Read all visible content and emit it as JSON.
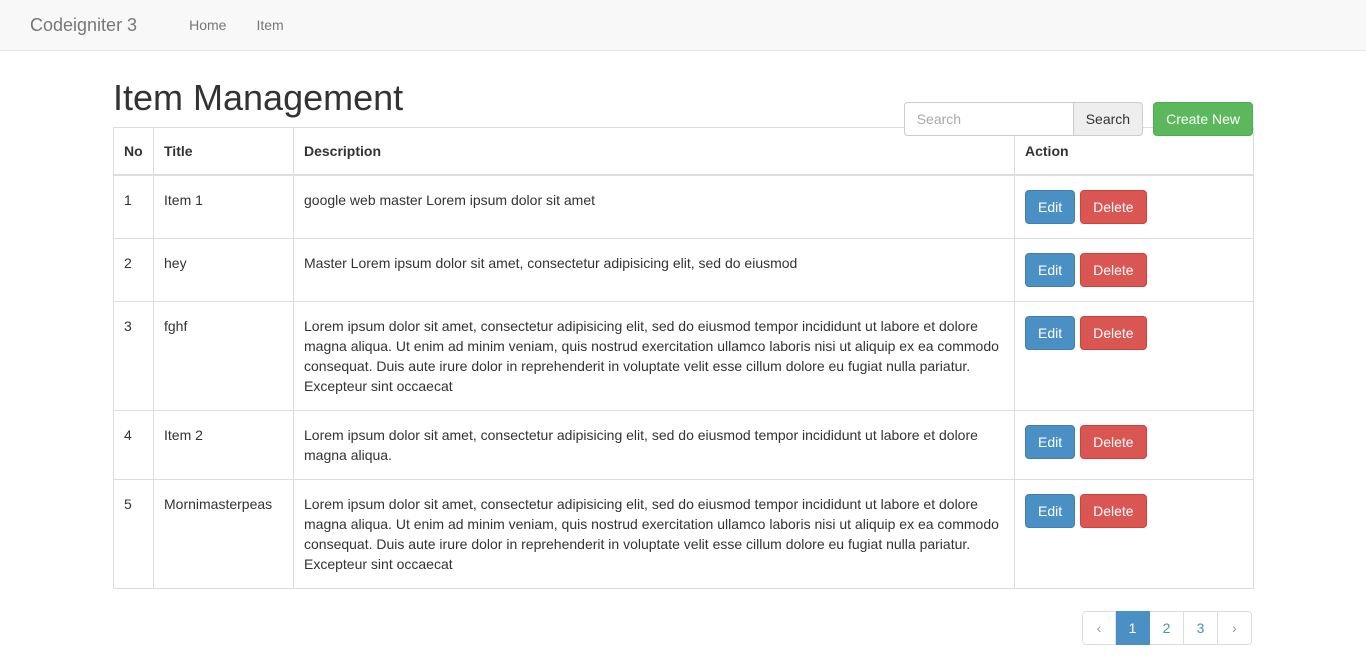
{
  "navbar": {
    "brand": "Codeigniter 3",
    "links": [
      {
        "label": "Home"
      },
      {
        "label": "Item"
      }
    ]
  },
  "page": {
    "title": "Item Management"
  },
  "search": {
    "value": "",
    "placeholder": "Search",
    "button_label": "Search"
  },
  "create": {
    "label": "Create New"
  },
  "table": {
    "headers": {
      "no": "No",
      "title": "Title",
      "description": "Description",
      "action": "Action"
    },
    "actions": {
      "edit": "Edit",
      "delete": "Delete"
    },
    "rows": [
      {
        "no": "1",
        "title": "Item 1",
        "description": "google web master Lorem ipsum dolor sit amet"
      },
      {
        "no": "2",
        "title": "hey",
        "description": "Master Lorem ipsum dolor sit amet, consectetur adipisicing elit, sed do eiusmod"
      },
      {
        "no": "3",
        "title": "fghf",
        "description": "Lorem ipsum dolor sit amet, consectetur adipisicing elit, sed do eiusmod tempor incididunt ut labore et dolore magna aliqua. Ut enim ad minim veniam, quis nostrud exercitation ullamco laboris nisi ut aliquip ex ea commodo consequat. Duis aute irure dolor in reprehenderit in voluptate velit esse cillum dolore eu fugiat nulla pariatur. Excepteur sint occaecat"
      },
      {
        "no": "4",
        "title": "Item 2",
        "description": "Lorem ipsum dolor sit amet, consectetur adipisicing elit, sed do eiusmod tempor incididunt ut labore et dolore magna aliqua."
      },
      {
        "no": "5",
        "title": "Mornimasterpeas",
        "description": "Lorem ipsum dolor sit amet, consectetur adipisicing elit, sed do eiusmod tempor incididunt ut labore et dolore magna aliqua. Ut enim ad minim veniam, quis nostrud exercitation ullamco laboris nisi ut aliquip ex ea commodo consequat. Duis aute irure dolor in reprehenderit in voluptate velit esse cillum dolore eu fugiat nulla pariatur. Excepteur sint occaecat"
      }
    ]
  },
  "pagination": {
    "prev_label": "‹",
    "next_label": "›",
    "pages": [
      {
        "label": "1",
        "active": true
      },
      {
        "label": "2",
        "active": false
      },
      {
        "label": "3",
        "active": false
      }
    ]
  },
  "colors": {
    "navbar_bg": "#f8f8f8",
    "navbar_border": "#e7e7e7",
    "primary": "#4a90c4",
    "success": "#5cb85c",
    "danger": "#da5652",
    "table_border": "#dddddd"
  }
}
